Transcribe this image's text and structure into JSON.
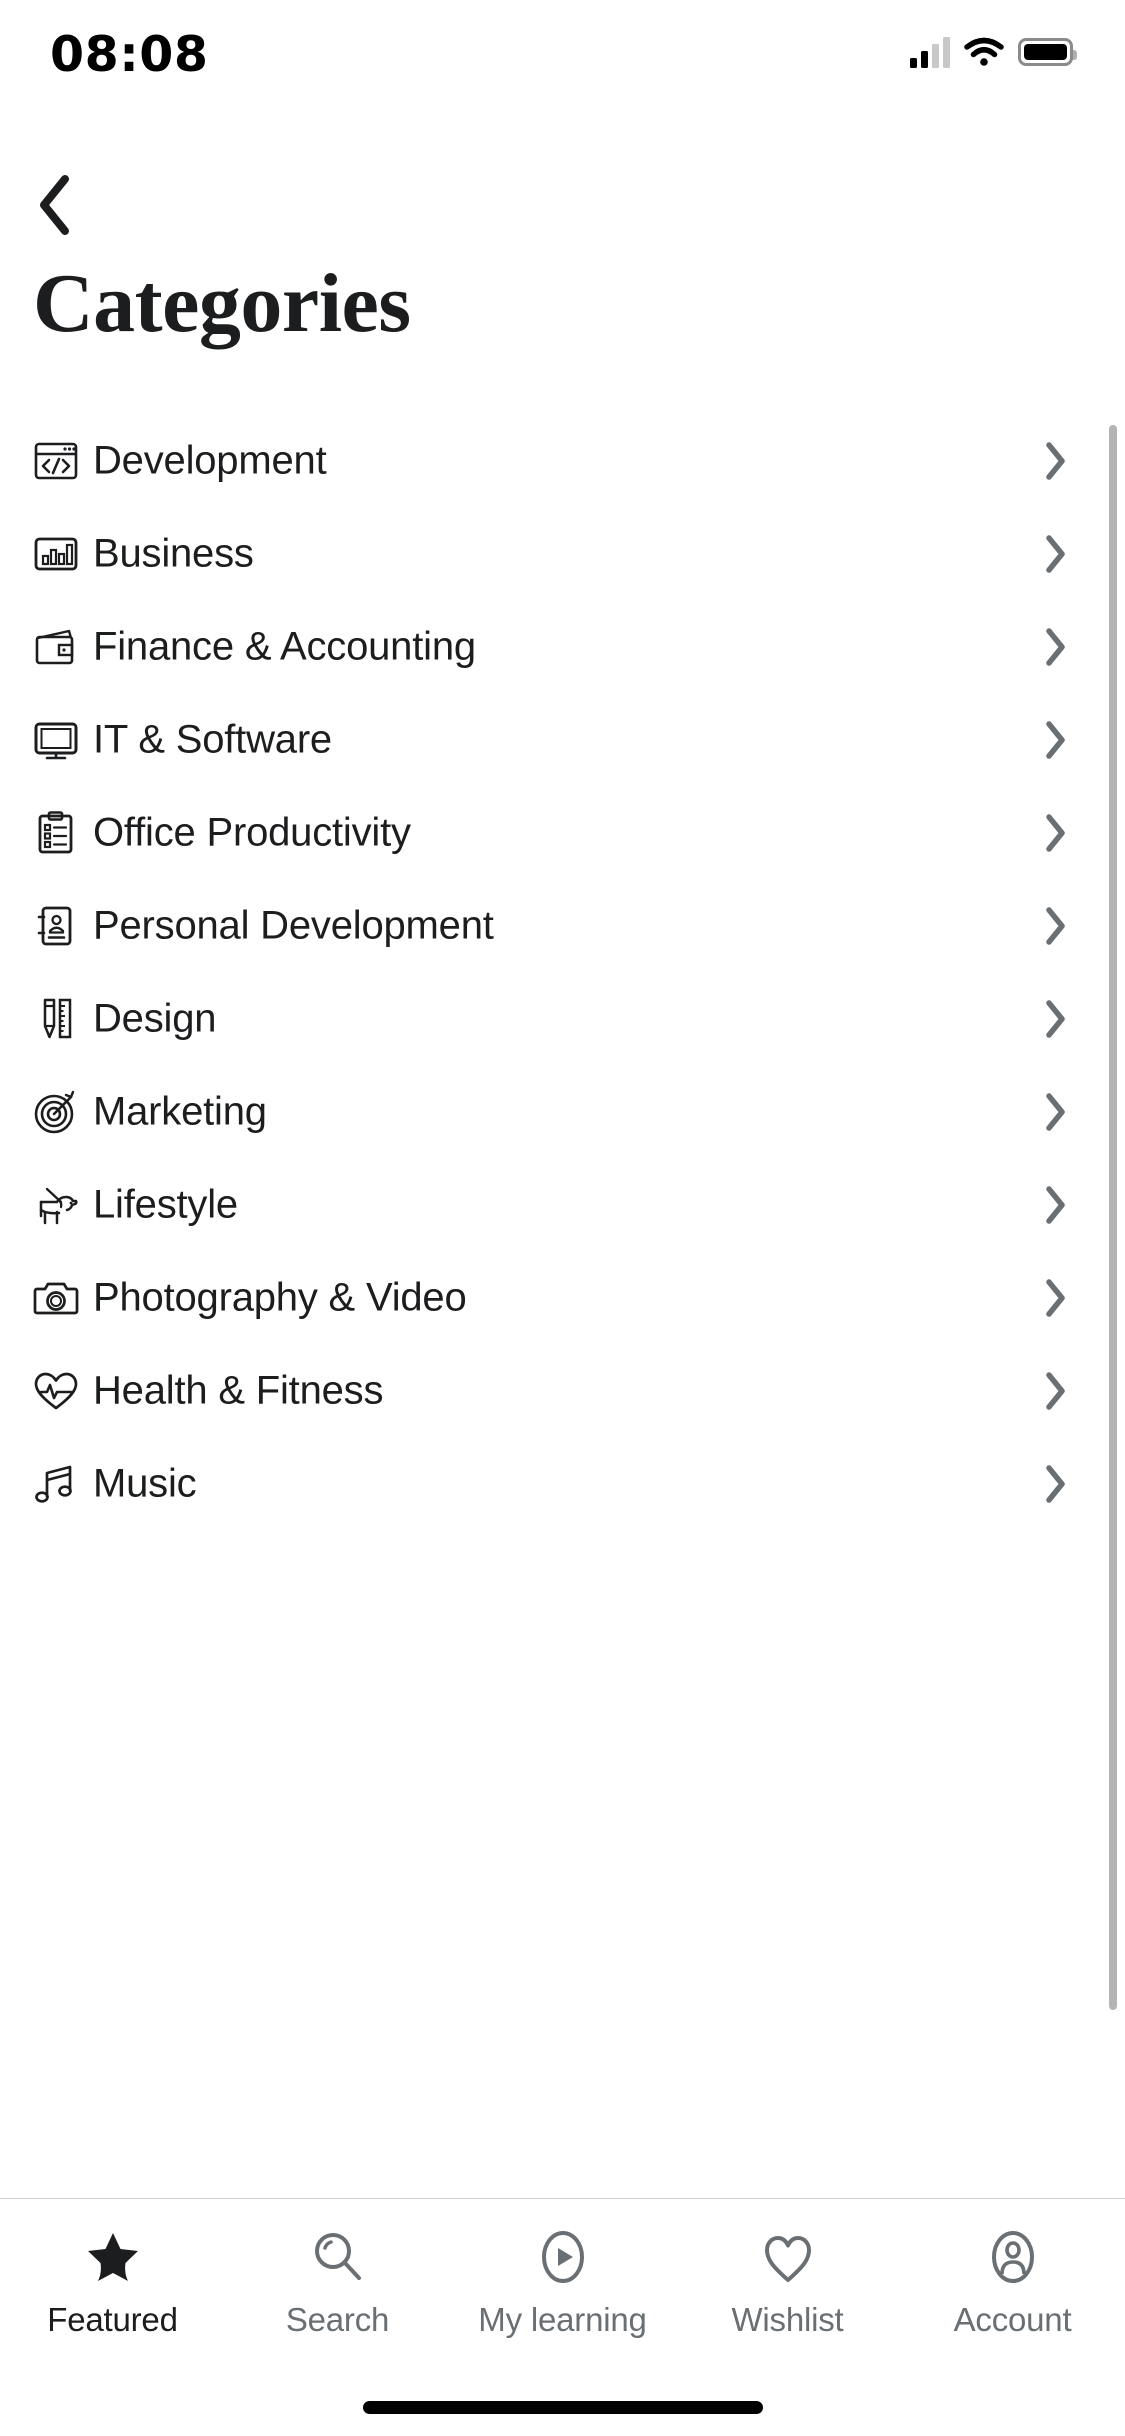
{
  "status_bar": {
    "time": "08:08",
    "signal_icon": "cellular-signal-icon",
    "wifi_icon": "wifi-icon",
    "battery_icon": "battery-icon"
  },
  "nav": {
    "back_icon": "chevron-left-icon"
  },
  "header": {
    "title": "Categories"
  },
  "colors": {
    "text_primary": "#1c1d1f",
    "text_muted": "#6a6f73",
    "chevron": "#6a6f73",
    "divider": "#d1d2d3",
    "scrollbar": "#b4b4b4"
  },
  "categories": [
    {
      "label": "Development",
      "icon": "code-window-icon",
      "chevron": "chevron-right-icon"
    },
    {
      "label": "Business",
      "icon": "bar-chart-icon",
      "chevron": "chevron-right-icon"
    },
    {
      "label": "Finance & Accounting",
      "icon": "wallet-icon",
      "chevron": "chevron-right-icon"
    },
    {
      "label": "IT & Software",
      "icon": "monitor-icon",
      "chevron": "chevron-right-icon"
    },
    {
      "label": "Office Productivity",
      "icon": "clipboard-list-icon",
      "chevron": "chevron-right-icon"
    },
    {
      "label": "Personal Development",
      "icon": "address-book-icon",
      "chevron": "chevron-right-icon"
    },
    {
      "label": "Design",
      "icon": "pencil-ruler-icon",
      "chevron": "chevron-right-icon"
    },
    {
      "label": "Marketing",
      "icon": "target-arrow-icon",
      "chevron": "chevron-right-icon"
    },
    {
      "label": "Lifestyle",
      "icon": "dog-leash-icon",
      "chevron": "chevron-right-icon"
    },
    {
      "label": "Photography & Video",
      "icon": "camera-icon",
      "chevron": "chevron-right-icon"
    },
    {
      "label": "Health & Fitness",
      "icon": "heart-pulse-icon",
      "chevron": "chevron-right-icon"
    },
    {
      "label": "Music",
      "icon": "music-note-icon",
      "chevron": "chevron-right-icon"
    }
  ],
  "tab_bar": {
    "items": [
      {
        "label": "Featured",
        "icon": "star-filled-icon",
        "active": true
      },
      {
        "label": "Search",
        "icon": "search-icon",
        "active": false
      },
      {
        "label": "My learning",
        "icon": "play-circle-icon",
        "active": false
      },
      {
        "label": "Wishlist",
        "icon": "heart-icon",
        "active": false
      },
      {
        "label": "Account",
        "icon": "user-circle-icon",
        "active": false
      }
    ]
  }
}
